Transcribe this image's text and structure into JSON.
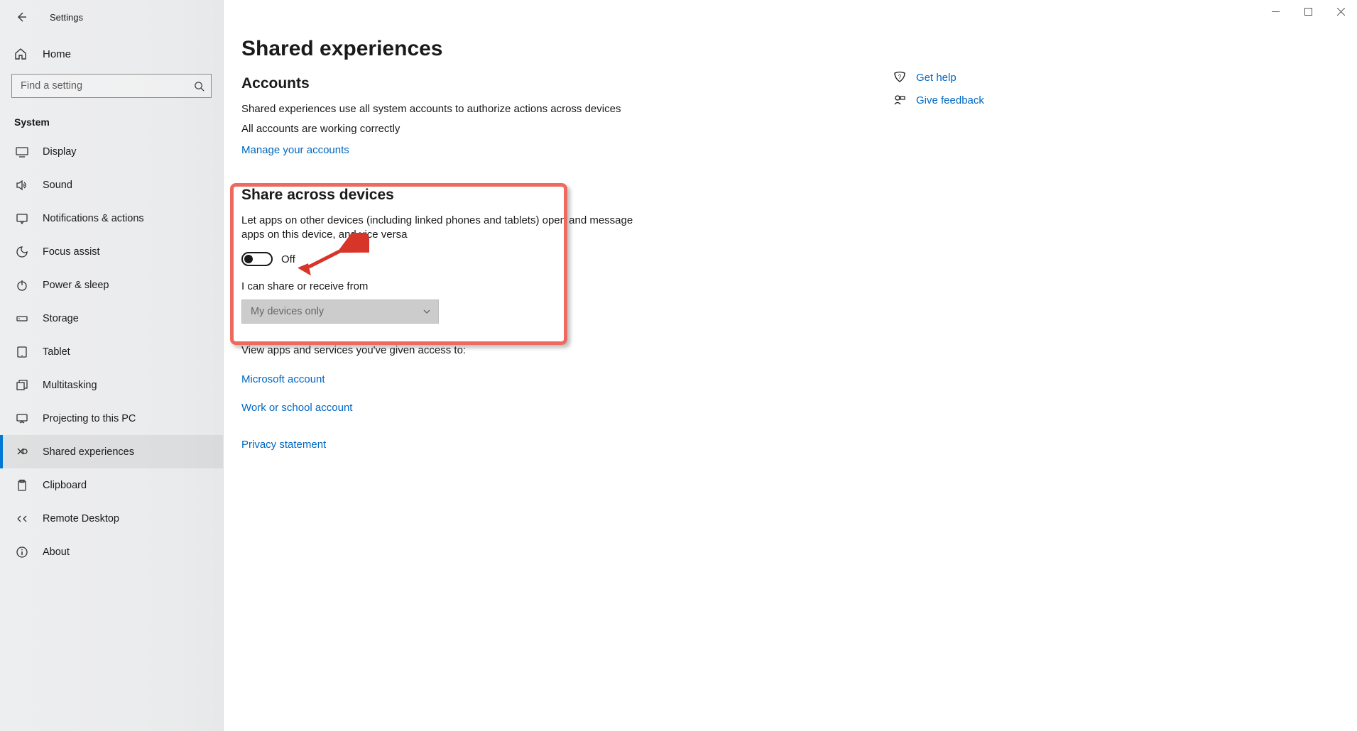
{
  "window_title": "Settings",
  "home_label": "Home",
  "search_placeholder": "Find a setting",
  "category_title": "System",
  "nav": [
    {
      "label": "Display"
    },
    {
      "label": "Sound"
    },
    {
      "label": "Notifications & actions"
    },
    {
      "label": "Focus assist"
    },
    {
      "label": "Power & sleep"
    },
    {
      "label": "Storage"
    },
    {
      "label": "Tablet"
    },
    {
      "label": "Multitasking"
    },
    {
      "label": "Projecting to this PC"
    },
    {
      "label": "Shared experiences"
    },
    {
      "label": "Clipboard"
    },
    {
      "label": "Remote Desktop"
    },
    {
      "label": "About"
    }
  ],
  "active_nav_index": 9,
  "page": {
    "title": "Shared experiences",
    "accounts_heading": "Accounts",
    "accounts_desc": "Shared experiences use all system accounts to authorize actions across devices",
    "accounts_status": "All accounts are working correctly",
    "manage_accounts": "Manage your accounts",
    "share_heading": "Share across devices",
    "share_desc": "Let apps on other devices (including linked phones and tablets) open and message apps on this device, and vice versa",
    "toggle_state": "Off",
    "receive_label": "I can share or receive from",
    "receive_value": "My devices only",
    "view_apps_label": "View apps and services you've given access to:",
    "ms_account": "Microsoft account",
    "work_account": "Work or school account",
    "privacy": "Privacy statement"
  },
  "side": {
    "get_help": "Get help",
    "give_feedback": "Give feedback"
  }
}
